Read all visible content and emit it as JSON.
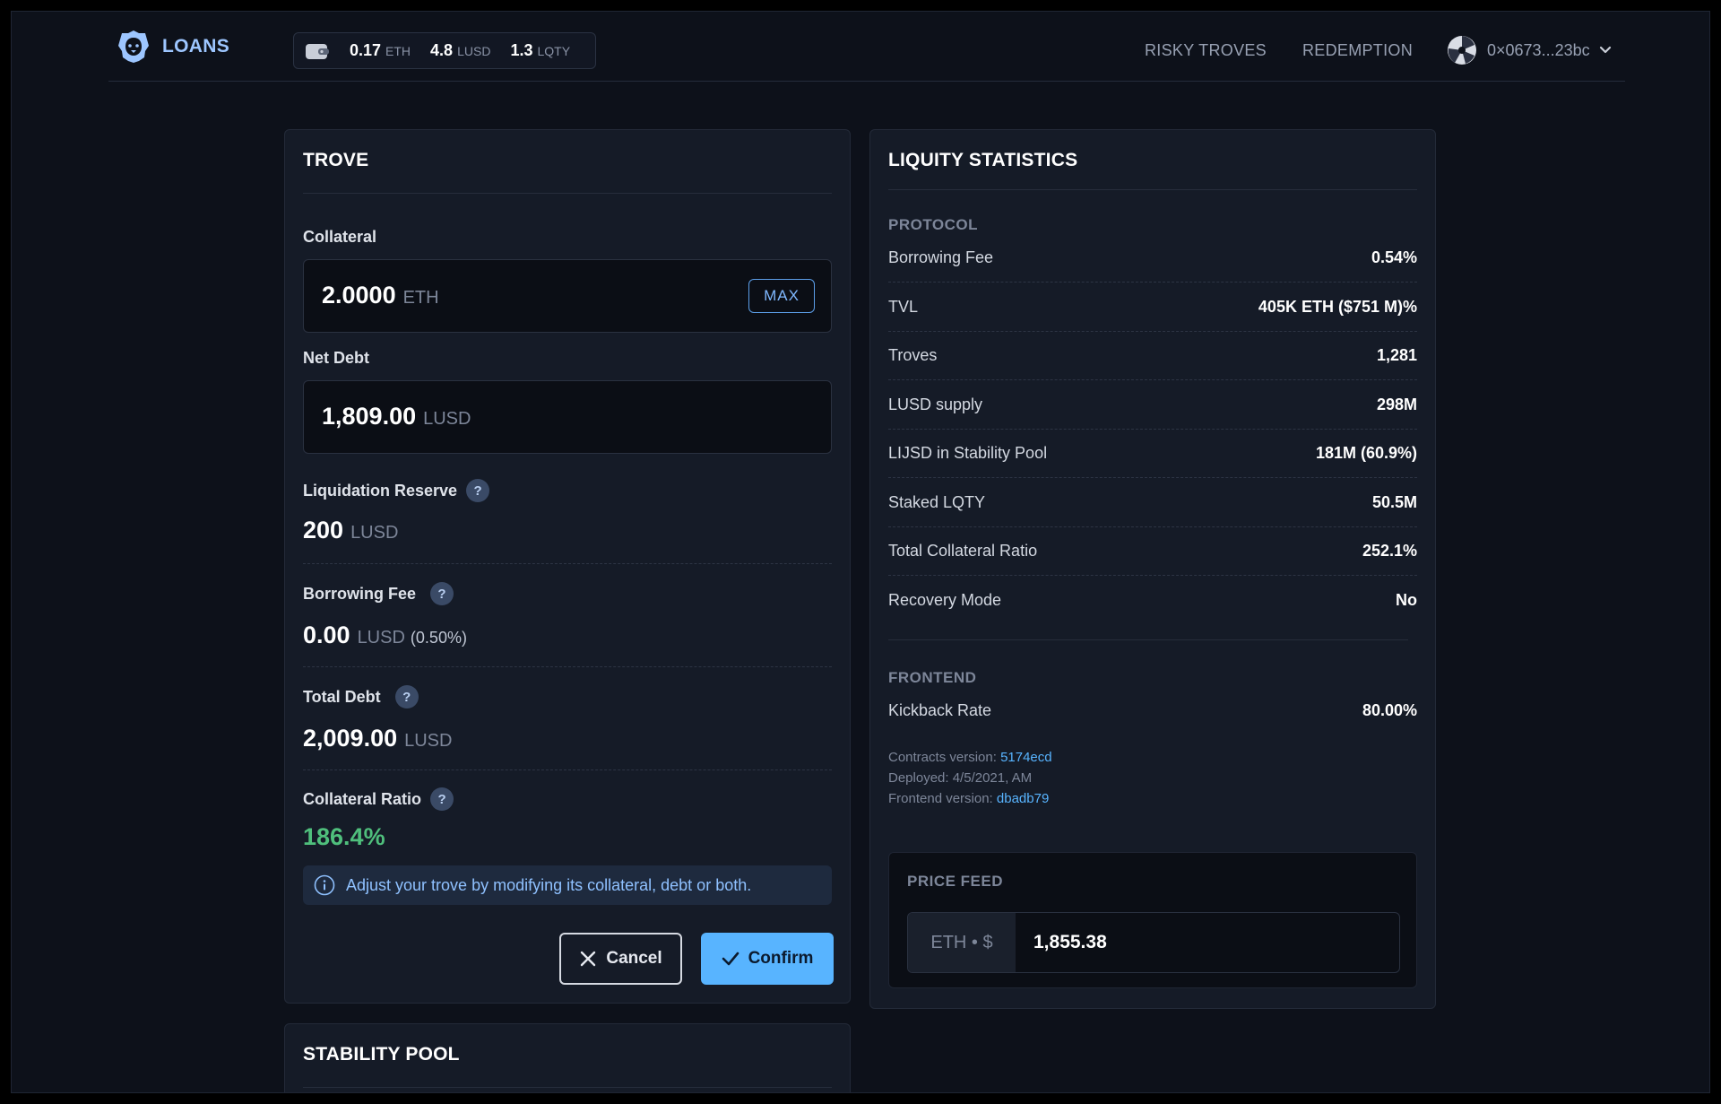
{
  "header": {
    "app_name": "LOANS",
    "balances": [
      {
        "amount": "0.17",
        "unit": "ETH"
      },
      {
        "amount": "4.8",
        "unit": "LUSD"
      },
      {
        "amount": "1.3",
        "unit": "LQTY"
      }
    ],
    "nav": {
      "risky_troves": "RISKY TROVES",
      "redemption": "REDEMPTION"
    },
    "account_address": "0×0673...23bc"
  },
  "trove": {
    "title": "TROVE",
    "collateral": {
      "label": "Collateral",
      "value": "2.0000",
      "unit": "ETH",
      "max_label": "MAX"
    },
    "net_debt": {
      "label": "Net Debt",
      "value": "1,809.00",
      "unit": "LUSD"
    },
    "liquidation_reserve": {
      "label": "Liquidation Reserve",
      "value": "200",
      "unit": "LUSD"
    },
    "borrowing_fee": {
      "label": "Borrowing Fee",
      "value": "0.00",
      "unit": "LUSD",
      "extra": "(0.50%)"
    },
    "total_debt": {
      "label": "Total Debt",
      "value": "2,009.00",
      "unit": "LUSD"
    },
    "collateral_ratio": {
      "label": "Collateral Ratio",
      "value": "186.4%"
    },
    "help_glyph": "?",
    "info_text": "Adjust your trove by modifying its collateral, debt or both.",
    "cancel_label": "Cancel",
    "confirm_label": "Confirm"
  },
  "stability_pool": {
    "title": "STABILITY POOL"
  },
  "statistics": {
    "title": "LIQUITY STATISTICS",
    "protocol_label": "PROTOCOL",
    "protocol_rows": [
      {
        "key": "Borrowing Fee",
        "value": "0.54%"
      },
      {
        "key": "TVL",
        "value": "405K ETH ($751 M)%"
      },
      {
        "key": "Troves",
        "value": "1,281"
      },
      {
        "key": "LUSD supply",
        "value": "298M"
      },
      {
        "key": "LIJSD in Stability Pool",
        "value": "181M (60.9%)"
      },
      {
        "key": "Staked LQTY",
        "value": "50.5M"
      },
      {
        "key": "Total Collateral Ratio",
        "value": "252.1%"
      },
      {
        "key": "Recovery Mode",
        "value": "No"
      }
    ],
    "frontend_label": "FRONTEND",
    "frontend_rows": [
      {
        "key": "Kickback Rate",
        "value": "80.00%"
      }
    ],
    "contracts_version_label": "Contracts version:",
    "contracts_version": "5174ecd",
    "deployed": "Deployed: 4/5/2021, AM",
    "frontend_version_label": "Frontend version:",
    "frontend_version": "dbadb79"
  },
  "price_feed": {
    "title": "PRICE FEED",
    "pair": "ETH • $",
    "value": "1,855.38"
  },
  "colors": {
    "background": "#0d111a",
    "card": "#151b27",
    "accent": "#58b4ff",
    "ratio_green": "#4fbf7c"
  }
}
